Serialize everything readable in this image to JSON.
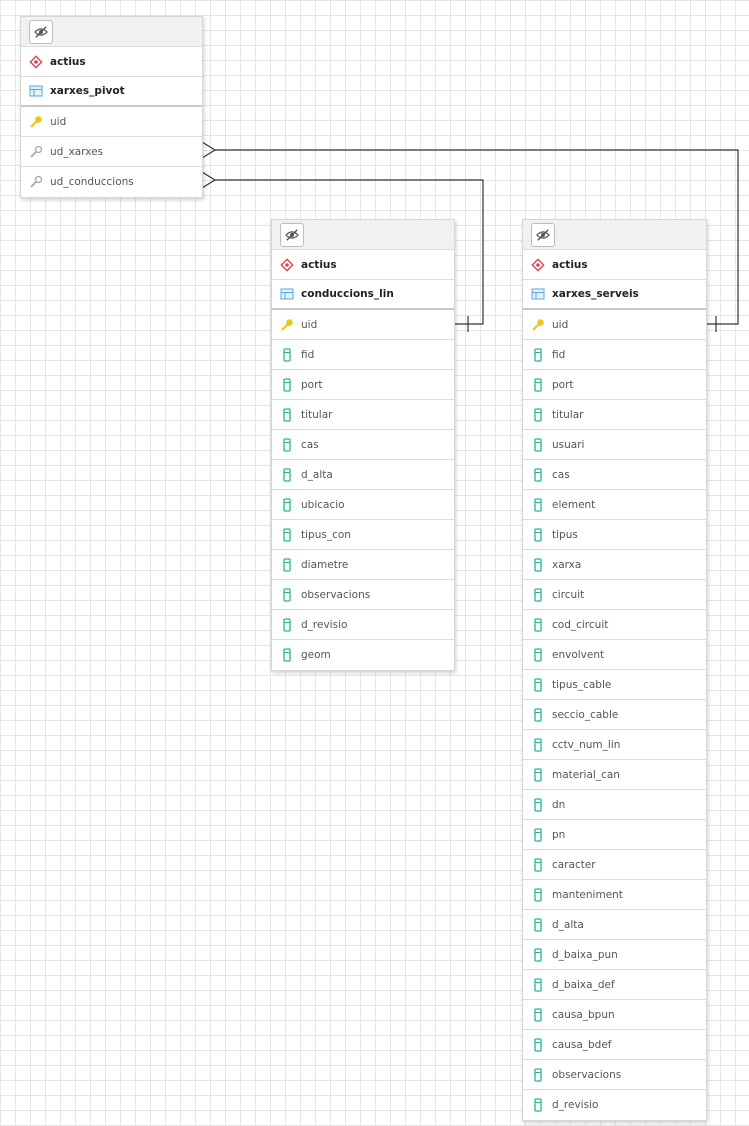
{
  "colors": {
    "schema_icon": "#e0424f",
    "table_icon": "#5aa7e0",
    "key_icon": "#e9c81c",
    "fk_icon": "#a8a8a8",
    "column_icon": "#2bb592"
  },
  "tables": [
    {
      "name": "xarxes_pivot",
      "schema": "actius",
      "columns": [
        {
          "name": "uid",
          "kind": "pk"
        },
        {
          "name": "ud_xarxes",
          "kind": "fk"
        },
        {
          "name": "ud_conduccions",
          "kind": "fk"
        }
      ]
    },
    {
      "name": "conduccions_lin",
      "schema": "actius",
      "columns": [
        {
          "name": "uid",
          "kind": "pk"
        },
        {
          "name": "fid",
          "kind": "col"
        },
        {
          "name": "port",
          "kind": "col"
        },
        {
          "name": "titular",
          "kind": "col"
        },
        {
          "name": "cas",
          "kind": "col"
        },
        {
          "name": "d_alta",
          "kind": "col"
        },
        {
          "name": "ubicacio",
          "kind": "col"
        },
        {
          "name": "tipus_con",
          "kind": "col"
        },
        {
          "name": "diametre",
          "kind": "col"
        },
        {
          "name": "observacions",
          "kind": "col"
        },
        {
          "name": "d_revisio",
          "kind": "col"
        },
        {
          "name": "geom",
          "kind": "col"
        }
      ]
    },
    {
      "name": "xarxes_serveis",
      "schema": "actius",
      "columns": [
        {
          "name": "uid",
          "kind": "pk"
        },
        {
          "name": "fid",
          "kind": "col"
        },
        {
          "name": "port",
          "kind": "col"
        },
        {
          "name": "titular",
          "kind": "col"
        },
        {
          "name": "usuari",
          "kind": "col"
        },
        {
          "name": "cas",
          "kind": "col"
        },
        {
          "name": "element",
          "kind": "col"
        },
        {
          "name": "tipus",
          "kind": "col"
        },
        {
          "name": "xarxa",
          "kind": "col"
        },
        {
          "name": "circuit",
          "kind": "col"
        },
        {
          "name": "cod_circuit",
          "kind": "col"
        },
        {
          "name": "envolvent",
          "kind": "col"
        },
        {
          "name": "tipus_cable",
          "kind": "col"
        },
        {
          "name": "seccio_cable",
          "kind": "col"
        },
        {
          "name": "cctv_num_lin",
          "kind": "col"
        },
        {
          "name": "material_can",
          "kind": "col"
        },
        {
          "name": "dn",
          "kind": "col"
        },
        {
          "name": "pn",
          "kind": "col"
        },
        {
          "name": "caracter",
          "kind": "col"
        },
        {
          "name": "manteniment",
          "kind": "col"
        },
        {
          "name": "d_alta",
          "kind": "col"
        },
        {
          "name": "d_baixa_pun",
          "kind": "col"
        },
        {
          "name": "d_baixa_def",
          "kind": "col"
        },
        {
          "name": "causa_bpun",
          "kind": "col"
        },
        {
          "name": "causa_bdef",
          "kind": "col"
        },
        {
          "name": "observacions",
          "kind": "col"
        },
        {
          "name": "d_revisio",
          "kind": "col"
        }
      ]
    }
  ]
}
